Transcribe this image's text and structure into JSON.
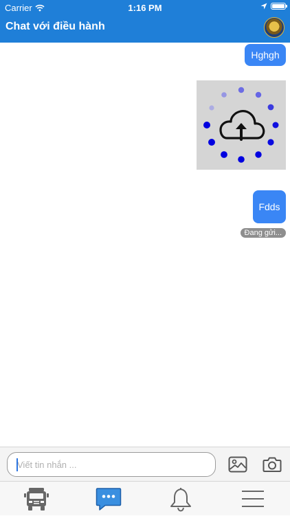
{
  "status_bar": {
    "carrier": "Carrier",
    "time": "1:16 PM"
  },
  "header": {
    "title": "Chat với điều hành"
  },
  "messages": [
    {
      "text": "Hghgh",
      "type": "text",
      "sender": "me"
    },
    {
      "type": "image-uploading",
      "sender": "me",
      "icon": "cloud-upload-icon"
    },
    {
      "text": "Fdds",
      "type": "text",
      "sender": "me",
      "status": "Đang gửi..."
    }
  ],
  "composer": {
    "placeholder": "Viết tin nhắn ...",
    "value": ""
  },
  "tabs": [
    {
      "icon": "truck-icon",
      "active": false
    },
    {
      "icon": "chat-bubble-icon",
      "active": true
    },
    {
      "icon": "bell-icon",
      "active": false
    },
    {
      "icon": "menu-icon",
      "active": false
    }
  ],
  "colors": {
    "header_bg": "#1f7fd8",
    "bubble_bg": "#3a86f5",
    "active_tab": "#3a8fe0",
    "inactive_tab": "#666666",
    "sending_badge_bg": "#8e8e8e"
  }
}
